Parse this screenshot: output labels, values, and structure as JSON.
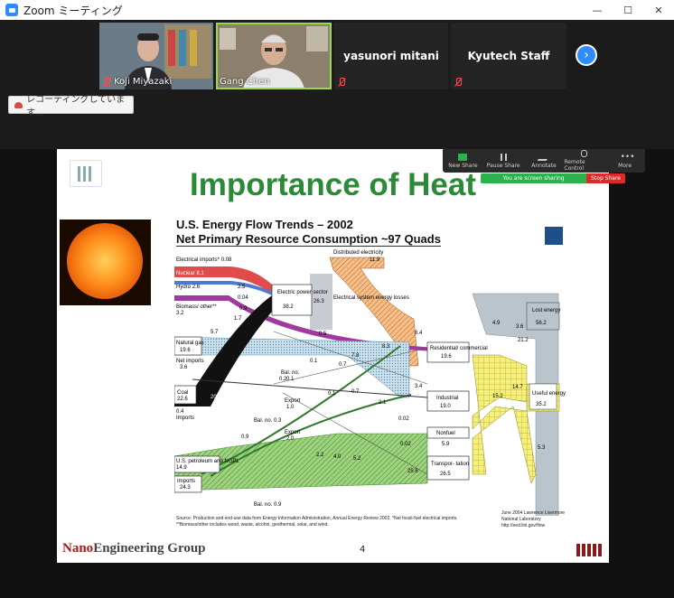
{
  "window": {
    "title": "Zoom ミーティング"
  },
  "participants": [
    {
      "name": "Koji Miyazaki",
      "video": true,
      "muted": true
    },
    {
      "name": "Gang Chen",
      "video": true,
      "muted": true,
      "active_speaker": true
    },
    {
      "name": "yasunori mitani",
      "video": false,
      "muted": true
    },
    {
      "name": "Kyutech Staff",
      "video": false,
      "muted": true
    }
  ],
  "recording": {
    "label": "レコーディングしています..."
  },
  "share_toolbar": {
    "items": [
      "New Share",
      "Pause Share",
      "Annotate",
      "Remote Control",
      "More"
    ],
    "status": "You are screen sharing",
    "stop_label": "Stop Share"
  },
  "slide": {
    "title": "Importance of Heat",
    "footer_nano": "Nano",
    "footer_rest": "Engineering Group",
    "page_number": "4",
    "chart": {
      "title": "U.S. Energy Flow Trends – 2002",
      "subtitle": "Net Primary Resource Consumption ~97 Quads",
      "source": "Source: Production and end-use data from Energy Information Administration, Annual Energy Review 2002. *Net fossil-fuel electrical imports. **Biomass/other includes wood, waste, alcohol, geothermal, solar, and wind.",
      "credit": "June 2004 Lawrence Livermore National Laboratory http://eed.llnl.gov/flow",
      "sources": [
        {
          "label": "Electrical imports*",
          "value": "0.08"
        },
        {
          "label": "Nuclear",
          "value": "8.1"
        },
        {
          "label": "Hydro",
          "value": "2.6"
        },
        {
          "label": "Biomass/ other**",
          "value": "3.2"
        },
        {
          "label": "Natural gas",
          "value": "19.6"
        },
        {
          "label": "Net imports",
          "value": "3.6"
        },
        {
          "label": "Coal",
          "value": "22.6"
        },
        {
          "label": "Imports",
          "value": "0.4"
        },
        {
          "label": "U.S. petroleum and NGPL",
          "value": "14.9"
        },
        {
          "label": "Imports",
          "value": "24.3"
        }
      ],
      "nodes": [
        {
          "label": "Electric power sector",
          "value": "38.2"
        },
        {
          "label": "Distributed electricity",
          "value": "11.9"
        },
        {
          "label": "Electrical system energy losses",
          "value": "26.3"
        },
        {
          "label": "Residential/ commercial",
          "value": "19.6"
        },
        {
          "label": "Industrial",
          "value": "19.0"
        },
        {
          "label": "Nonfuel",
          "value": "5.9"
        },
        {
          "label": "Transpor- tation",
          "value": "26.5"
        },
        {
          "label": "Lost energy",
          "value": "56.2"
        },
        {
          "label": "Useful energy",
          "value": "35.2"
        }
      ],
      "flow_labels": [
        "2.5",
        "0.04",
        "0.9",
        "1.7",
        "5.7",
        "0.5",
        "8.3",
        "7.8",
        "0.7",
        "0.1",
        "0.2",
        "0.7",
        "0.1",
        "20.0",
        "2.1",
        "0.02",
        "0.02",
        "8.4",
        "3.4",
        "4.9",
        "3.6",
        "21.2",
        "14.7",
        "15.2",
        "5.3",
        "0.9",
        "2.2",
        "4.0",
        "5.2",
        "25.6"
      ],
      "misc_labels": [
        {
          "label": "Bal. no.",
          "value": "0.1"
        },
        {
          "label": "Export",
          "value": "1.0"
        },
        {
          "label": "Bal. no.",
          "value": "0.3"
        },
        {
          "label": "Export",
          "value": "2.0"
        },
        {
          "label": "Bal. no.",
          "value": "0.9"
        }
      ]
    }
  }
}
